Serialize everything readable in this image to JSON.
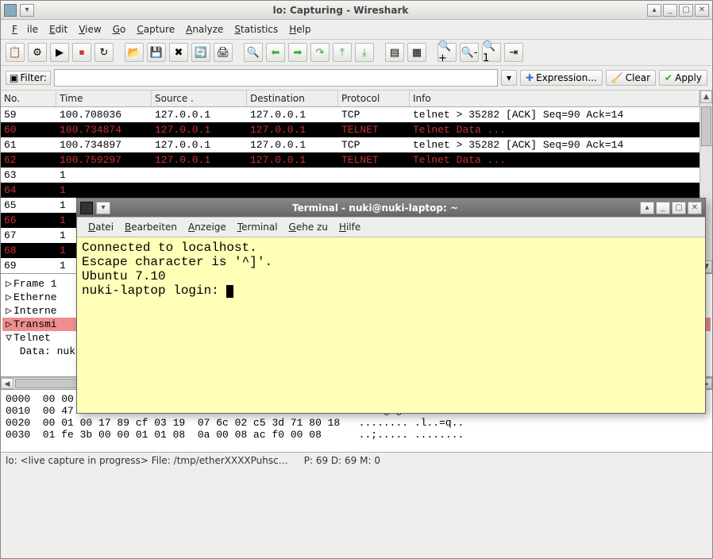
{
  "window": {
    "title": "lo: Capturing - Wireshark"
  },
  "menubar": [
    "File",
    "Edit",
    "View",
    "Go",
    "Capture",
    "Analyze",
    "Statistics",
    "Help"
  ],
  "filter": {
    "label": "Filter:",
    "value": "",
    "expr_btn": "Expression...",
    "clear_btn": "Clear",
    "apply_btn": "Apply"
  },
  "packet_headers": [
    "No.",
    "Time",
    "Source .",
    "Destination",
    "Protocol",
    "Info"
  ],
  "packets": [
    {
      "cls": "row-white",
      "no": "59",
      "time": "100.708036",
      "src": "127.0.0.1",
      "dst": "127.0.0.1",
      "proto": "TCP",
      "info": "telnet > 35282 [ACK] Seq=90 Ack=14"
    },
    {
      "cls": "row-black",
      "no": "60",
      "time": "100.734874",
      "src": "127.0.0.1",
      "dst": "127.0.0.1",
      "proto": "TELNET",
      "info": "Telnet Data ..."
    },
    {
      "cls": "row-white",
      "no": "61",
      "time": "100.734897",
      "src": "127.0.0.1",
      "dst": "127.0.0.1",
      "proto": "TCP",
      "info": "telnet > 35282 [ACK] Seq=90 Ack=14"
    },
    {
      "cls": "row-black",
      "no": "62",
      "time": "100.759297",
      "src": "127.0.0.1",
      "dst": "127.0.0.1",
      "proto": "TELNET",
      "info": "Telnet Data ..."
    },
    {
      "cls": "row-white",
      "no": "63",
      "time": "1",
      "src": "",
      "dst": "",
      "proto": "",
      "info": ""
    },
    {
      "cls": "row-black",
      "no": "64",
      "time": "1",
      "src": "",
      "dst": "",
      "proto": "",
      "info": ""
    },
    {
      "cls": "row-white",
      "no": "65",
      "time": "1",
      "src": "",
      "dst": "",
      "proto": "",
      "info": ""
    },
    {
      "cls": "row-black",
      "no": "66",
      "time": "1",
      "src": "",
      "dst": "",
      "proto": "",
      "info": ""
    },
    {
      "cls": "row-white",
      "no": "67",
      "time": "1",
      "src": "",
      "dst": "",
      "proto": "",
      "info": ""
    },
    {
      "cls": "row-black",
      "no": "68",
      "time": "1",
      "src": "",
      "dst": "",
      "proto": "",
      "info": ""
    },
    {
      "cls": "row-white",
      "no": "69",
      "time": "1",
      "src": "",
      "dst": "",
      "proto": "",
      "info": ""
    }
  ],
  "tree": [
    {
      "sym": "▷",
      "label": "Frame 1"
    },
    {
      "sym": "▷",
      "label": "Etherne"
    },
    {
      "sym": "▷",
      "label": "Interne"
    },
    {
      "sym": "▷",
      "label": "Transmi",
      "sel": true
    },
    {
      "sym": "▽",
      "label": "Telnet"
    },
    {
      "sym": " ",
      "label": "    Data: nuki-laptop login:"
    }
  ],
  "hex": [
    "0000  00 00 00 00 00 00 00 00  00 00 00 00 08 00 45 10   ........ ......E.",
    "0010  00 47 ab cb 40 00 40 06  90 d3 7f 00 00 01 7f 00   .G..@.@. ........",
    "0020  00 01 00 17 89 cf 03 19  07 6c 02 c5 3d 71 80 18   ........ .l..=q..",
    "0030  01 fe 3b 00 00 01 01 08  0a 00 08 ac f0 00 08      ..;..... ........"
  ],
  "status": {
    "left": "lo: <live capture in progress> File: /tmp/etherXXXXPuhsc…",
    "right": "P: 69 D: 69 M: 0"
  },
  "terminal": {
    "title": "Terminal - nuki@nuki-laptop: ~",
    "menu": [
      "Datei",
      "Bearbeiten",
      "Anzeige",
      "Terminal",
      "Gehe zu",
      "Hilfe"
    ],
    "lines": [
      "Connected to localhost.",
      "Escape character is '^]'.",
      "Ubuntu 7.10",
      "nuki-laptop login: "
    ]
  }
}
